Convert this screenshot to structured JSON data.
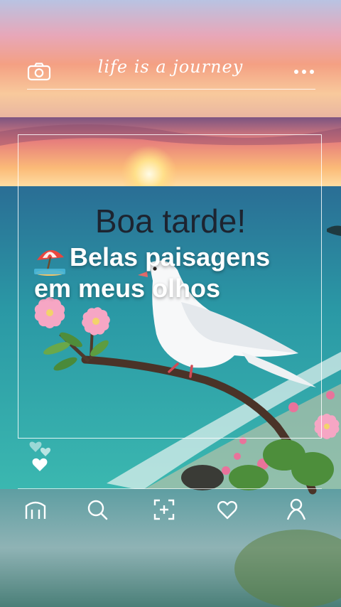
{
  "header": {
    "brand": "life is a journey",
    "camera_icon": "camera-icon",
    "more_icon": "more-dots-icon"
  },
  "post": {
    "greeting": "Boa tarde!",
    "caption_emoji_icon": "beach-umbrella-icon",
    "caption_line1": "Belas paisagens",
    "caption_line2": "em meus olhos"
  },
  "side_actions": {
    "hearts_icon": "floating-hearts-icon",
    "like_icon": "heart-icon"
  },
  "bottom_nav": [
    {
      "name": "home",
      "icon": "home-icon"
    },
    {
      "name": "search",
      "icon": "search-icon"
    },
    {
      "name": "create",
      "icon": "add-square-icon"
    },
    {
      "name": "activity",
      "icon": "heart-outline-icon"
    },
    {
      "name": "profile",
      "icon": "profile-icon"
    }
  ],
  "colors": {
    "sea": "#2a8a92",
    "sunset": "#f4a083",
    "text_dark": "#1d2430",
    "white": "#ffffff"
  }
}
